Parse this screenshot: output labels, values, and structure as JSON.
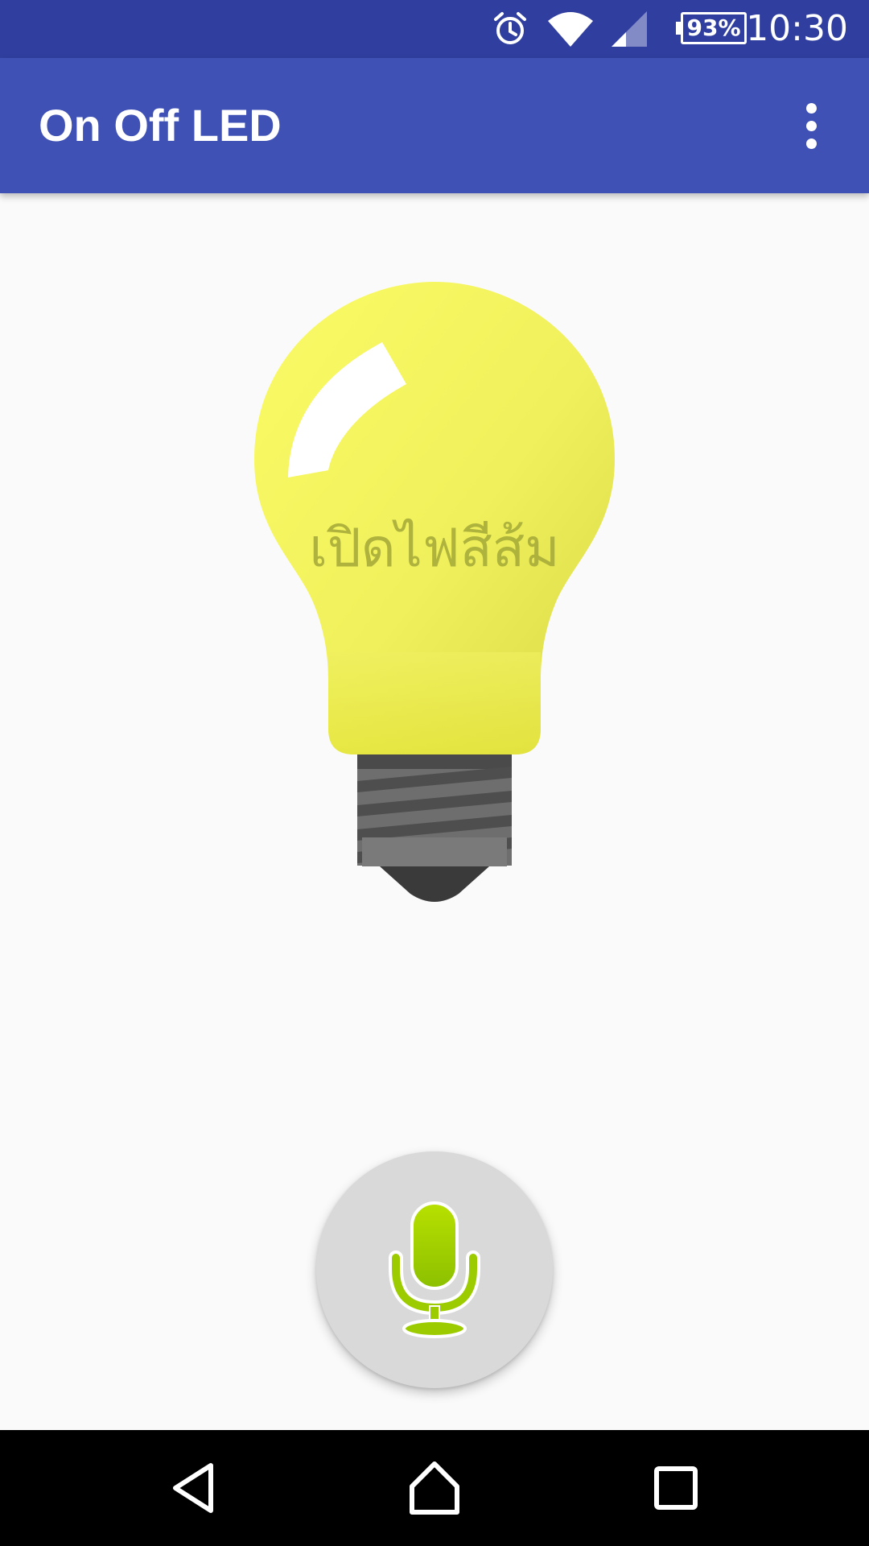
{
  "status_bar": {
    "time": "10:30",
    "battery_percent": "93%",
    "icons": [
      "alarm-icon",
      "wifi-icon",
      "cell-signal-icon",
      "battery-icon"
    ],
    "background_color": "#303f9f"
  },
  "app_bar": {
    "title": "On Off LED",
    "menu_icon": "more-vert-icon",
    "background_color": "#3f51b5"
  },
  "main": {
    "bulb": {
      "icon": "light-bulb-icon",
      "caption": "เปิดไฟสีส้ม",
      "glass_color": "#f2f25a"
    },
    "voice_button": {
      "icon": "microphone-icon",
      "icon_color": "#9ccc00"
    }
  },
  "nav_bar": {
    "buttons": [
      "back-icon",
      "home-icon",
      "recents-icon"
    ]
  }
}
